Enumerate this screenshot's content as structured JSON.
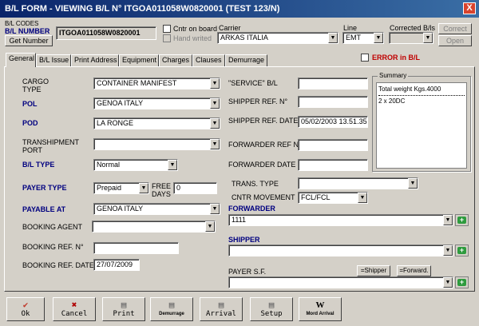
{
  "window": {
    "title": "B/L FORM - VIEWING B/L N° ITGOA011058W0820001     (TEST 123/N)",
    "close": "X"
  },
  "header": {
    "bl_codes_label": "B/L CODES",
    "bl_number_label": "B/L NUMBER",
    "get_number": "Get Number",
    "bl_number_value": "ITGOA011058W0820001",
    "cntr_on_board": "Cntr on board",
    "hand_writed": "Hand writed",
    "carrier_label": "Carrier",
    "carrier_value": "ARKAS ITALIA",
    "line_label": "Line",
    "line_value": "EMT",
    "corrected_label": "Corrected B/ls",
    "correct": "Correct",
    "open": "Open"
  },
  "tabs": [
    "General",
    "B/L Issue",
    "Print Address",
    "Equipment",
    "Charges",
    "Clauses",
    "Demurrage"
  ],
  "error_flag": "ERROR in B/L",
  "form": {
    "cargo_type_label1": "CARGO",
    "cargo_type_label2": "TYPE",
    "cargo_type": "CONTAINER MANIFEST",
    "pol_label": "POL",
    "pol": "GENOA ITALY",
    "pod_label": "POD",
    "pod": "LA RONGE",
    "transhipment_label1": "TRANSHIPMENT",
    "transhipment_label2": "PORT",
    "transhipment": "",
    "bl_type_label": "B/L TYPE",
    "bl_type": "Normal",
    "payer_type_label": "PAYER TYPE",
    "payer_type": "Prepaid",
    "free_days_label1": "FREE",
    "free_days_label2": "DAYS",
    "free_days": "0",
    "payable_at_label": "PAYABLE AT",
    "payable_at": "GENOA ITALY",
    "booking_agent_label": "BOOKING AGENT",
    "booking_agent": "",
    "booking_ref_label": "BOOKING REF. N°",
    "booking_ref": "",
    "booking_date_label": "BOOKING REF. DATE",
    "booking_date": "27/07/2009",
    "service_label": "\"SERVICE\" B/L",
    "service": "",
    "shipper_ref_label": "SHIPPER REF. N°",
    "shipper_ref": "",
    "shipper_date_label": "SHIPPER REF. DATE",
    "shipper_date": "05/02/2003 13.51.35",
    "forwarder_ref_label": "FORWARDER REF N°",
    "forwarder_ref": "",
    "forwarder_date_label": "FORWARDER DATE",
    "forwarder_date": "",
    "trans_type_label": "TRANS. TYPE",
    "trans_type": "",
    "cntr_movement_label": "CNTR MOVEMENT",
    "cntr_movement": "FCL/FCL",
    "forwarder_label": "FORWARDER",
    "forwarder": "1111",
    "shipper_label": "SHIPPER",
    "shipper": "",
    "payer_sf_label": "PAYER S.F.",
    "eq_shipper": "=Shipper",
    "eq_forward": "=Forward.",
    "payer_sf": ""
  },
  "summary": {
    "title": "Summary",
    "line1": "Total weight Kgs.4000",
    "line2": "2 x 20DC"
  },
  "toolbar": {
    "ok": "Ok",
    "cancel": "Cancel",
    "print": "Print",
    "demurrage": "Demurrage",
    "arrival": "Arrival",
    "setup": "Setup",
    "mord_arrival": "Mord Arrival"
  },
  "colors": {
    "title_bar": "#0a246a",
    "label_blue": "#000080",
    "error_red": "#c00000",
    "add_green": "#2e9b3e"
  }
}
